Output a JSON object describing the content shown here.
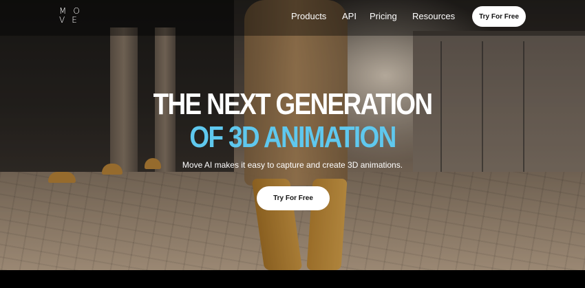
{
  "nav": {
    "logo_row1": "MO",
    "logo_row2": "VE",
    "links": [
      "Products",
      "API",
      "Pricing",
      "Resources"
    ],
    "cta_label": "Try For Free"
  },
  "hero": {
    "headline_line1": "THE NEXT GENERATION",
    "headline_line2": "OF 3D ANIMATION",
    "subtitle": "Move AI makes it easy to capture and create 3D animations.",
    "cta_label": "Try For Free"
  },
  "colors": {
    "accent": "#5fc8ee",
    "button_bg": "#ffffff",
    "text": "#ffffff"
  }
}
